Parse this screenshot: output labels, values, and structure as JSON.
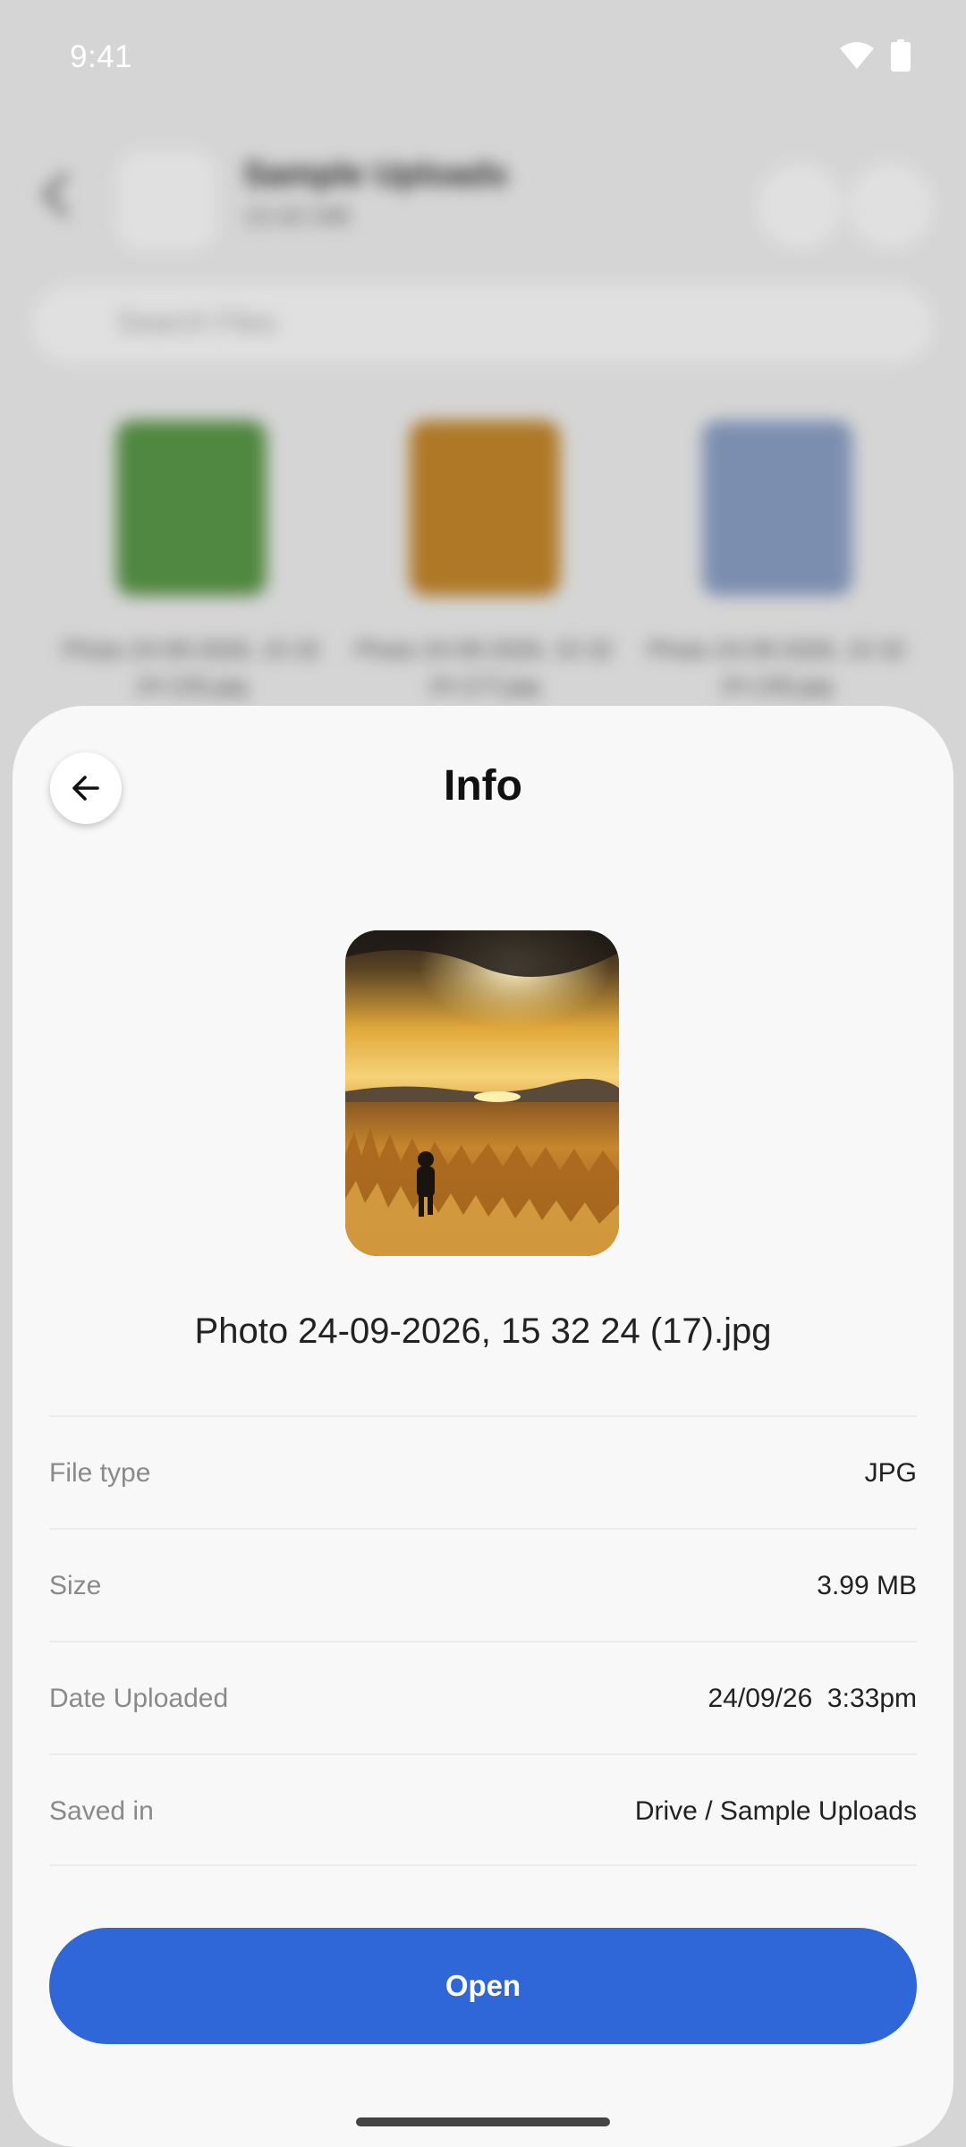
{
  "status_bar": {
    "time": "9:41",
    "icons": [
      "wifi-icon",
      "battery-icon"
    ]
  },
  "background_screen": {
    "folder_title": "Sample Uploads",
    "folder_size": "15.63 MB",
    "search_placeholder": "Search Files",
    "thumbnails": [
      {
        "caption": "Photo 24-09-2026, 15 32 24 (16).jpg",
        "color": "#5c9a4a"
      },
      {
        "caption": "Photo 24-09-2026, 15 32 24 (17).jpg",
        "color": "#c7892c"
      },
      {
        "caption": "Photo 24-09-2026, 15 32 24 (18).jpg",
        "color": "#8ea2c8"
      }
    ]
  },
  "sheet": {
    "title": "Info",
    "back_icon": "arrow-left-icon",
    "file_name": "Photo 24-09-2026, 15 32 24 (17).jpg",
    "details": [
      {
        "label": "File type",
        "value": "JPG"
      },
      {
        "label": "Size",
        "value": "3.99 MB"
      },
      {
        "label": "Date Uploaded",
        "value": "24/09/26  3:33pm"
      },
      {
        "label": "Saved in",
        "value": "Drive / Sample Uploads"
      }
    ],
    "open_button": "Open"
  },
  "colors": {
    "primary": "#2f66d8",
    "sheet_background": "#f8f8f8",
    "label_text": "#8a8a8a"
  }
}
